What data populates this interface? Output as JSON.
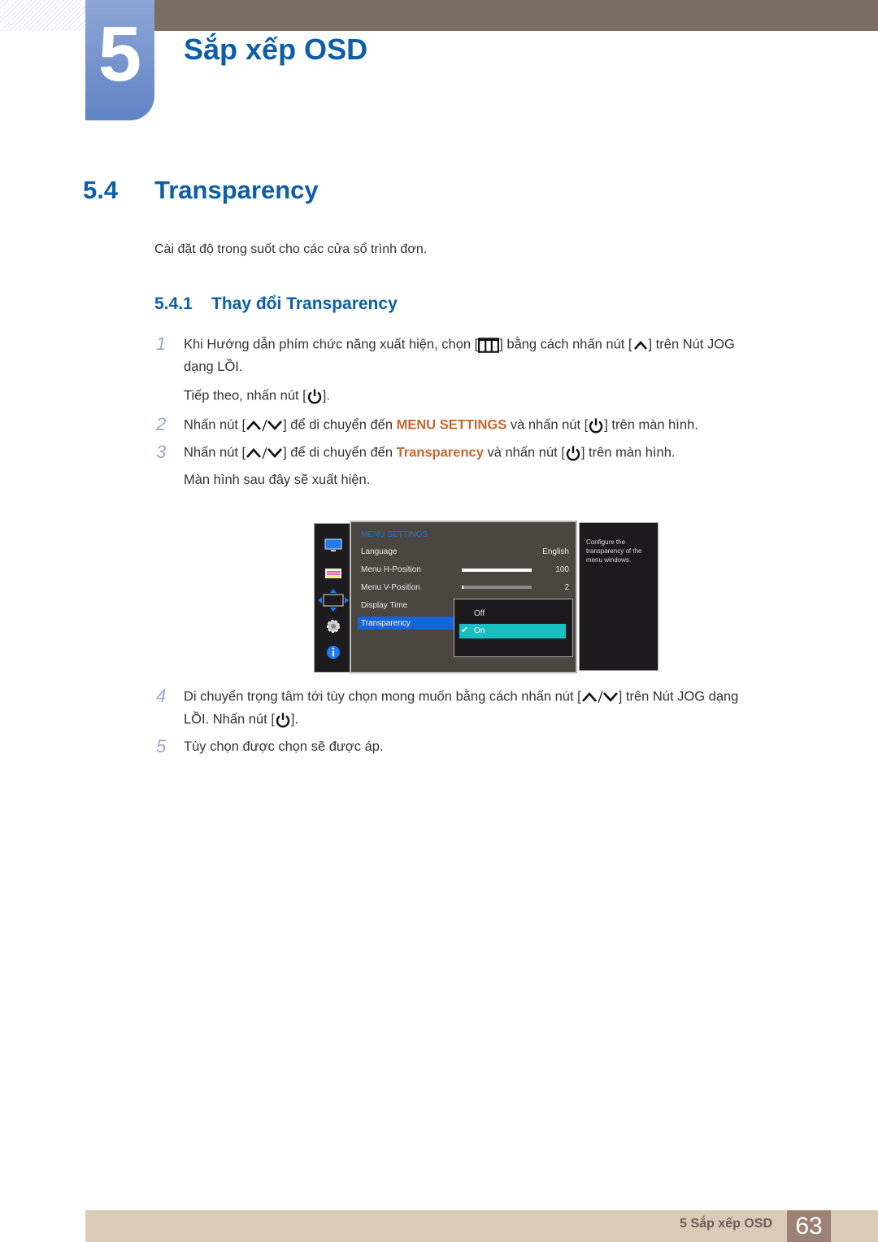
{
  "chapter": {
    "number": "5",
    "title": "Sắp xếp OSD"
  },
  "section": {
    "number": "5.4",
    "title": "Transparency"
  },
  "intro": "Cài đặt độ trong suốt cho các cửa sổ trình đơn.",
  "subsection": {
    "number": "5.4.1",
    "title": "Thay đổi Transparency"
  },
  "steps": [
    {
      "num": "1",
      "line1_a": "Khi Hướng dẫn phím chức năng xuất hiện, chọn [",
      "line1_b": "] bằng cách nhấn nút [",
      "line1_c": "] trên Nút JOG",
      "line2": "dạng LỒI.",
      "line3_a": "Tiếp theo, nhấn nút [",
      "line3_b": "]."
    },
    {
      "num": "2",
      "a": "Nhấn nút [",
      "b": "] để di chuyển đến ",
      "hl": "MENU SETTINGS",
      "c": " và nhấn nút [",
      "d": "] trên màn hình."
    },
    {
      "num": "3",
      "a": "Nhấn nút [",
      "b": "] để di chuyển đến ",
      "hl": "Transparency",
      "c": " và nhấn nút [",
      "d": "] trên màn hình.",
      "line2": "Màn hình sau đây sẽ xuất hiện."
    },
    {
      "num": "4",
      "a": "Di chuyển trọng tâm tới tùy chọn mong muốn bằng cách nhấn nút [",
      "b": "] trên Nút JOG dạng",
      "line2_a": "LỒI. Nhấn nút [",
      "line2_b": "]."
    },
    {
      "num": "5",
      "text": "Tùy chọn được chọn sẽ được áp."
    }
  ],
  "osd": {
    "title": "MENU SETTINGS",
    "items": [
      {
        "label": "Language",
        "value": "English"
      },
      {
        "label": "Menu H-Position",
        "value": "100",
        "level": 1.0
      },
      {
        "label": "Menu V-Position",
        "value": "2",
        "level": 0.02
      },
      {
        "label": "Display Time",
        "value": ""
      },
      {
        "label": "Transparency",
        "value": ""
      }
    ],
    "options": [
      "Off",
      "On"
    ],
    "selected_option": "On",
    "help": "Configure the transparency of the menu windows.",
    "colors": {
      "accent": "#1565d8",
      "selected": "#19bec0",
      "title": "#1e6fdc"
    }
  },
  "footer": {
    "label": "5 Sắp xếp OSD",
    "page": "63"
  }
}
